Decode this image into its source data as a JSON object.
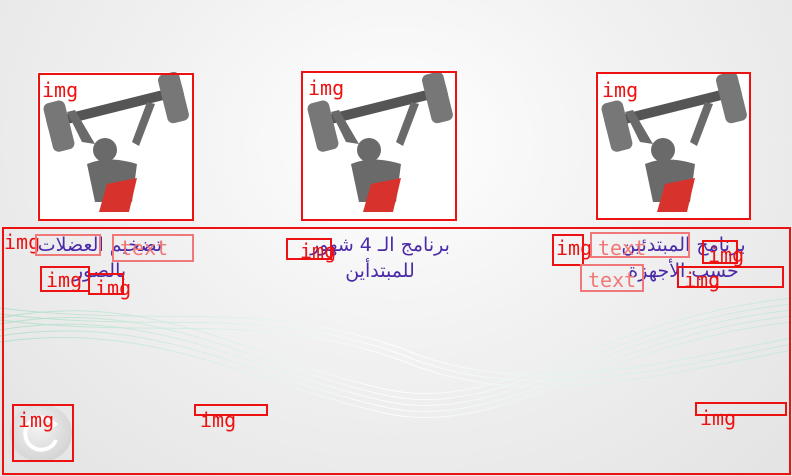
{
  "cards": [
    {
      "title_line1": "تضخيم العضلات",
      "title_line2": "بالصور"
    },
    {
      "title_line1": "برنامج الـ 4 شهور",
      "title_line2": "للمبتدأين"
    },
    {
      "title_line1": "برنامج المبتدئين",
      "title_line2": "حسب الأجهزة"
    }
  ],
  "annotations": {
    "img": "img",
    "text": "text"
  },
  "colors": {
    "title": "#4b2aa8",
    "box": "#e11111",
    "box_text": "#f07878",
    "wave": "#b9e3cf"
  },
  "icons": [
    "weightlifter-icon",
    "reload-icon"
  ]
}
